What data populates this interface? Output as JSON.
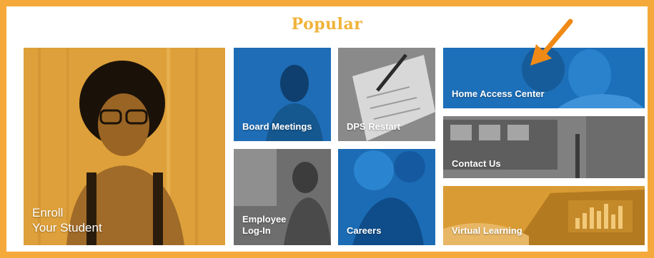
{
  "section": {
    "title": "Popular"
  },
  "tiles": {
    "enroll": {
      "label_line1": "Enroll",
      "label_line2": "Your Student"
    },
    "board": {
      "label": "Board Meetings"
    },
    "restart": {
      "label": "DPS Restart"
    },
    "hac": {
      "label": "Home Access Center"
    },
    "employee": {
      "label_line1": "Employee",
      "label_line2": "Log-In"
    },
    "careers": {
      "label": "Careers"
    },
    "contact": {
      "label": "Contact Us"
    },
    "virtual": {
      "label": "Virtual Learning"
    }
  },
  "colors": {
    "page_bg": "#f6a93b",
    "frame_border": "#f6a93b",
    "title": "#f0b33b",
    "gold": "#e9a93a",
    "blue": "#1d6fb8",
    "gray": "#7f7f7f",
    "arrow": "#f08a16"
  },
  "annotation": {
    "icon": "arrow-icon"
  }
}
